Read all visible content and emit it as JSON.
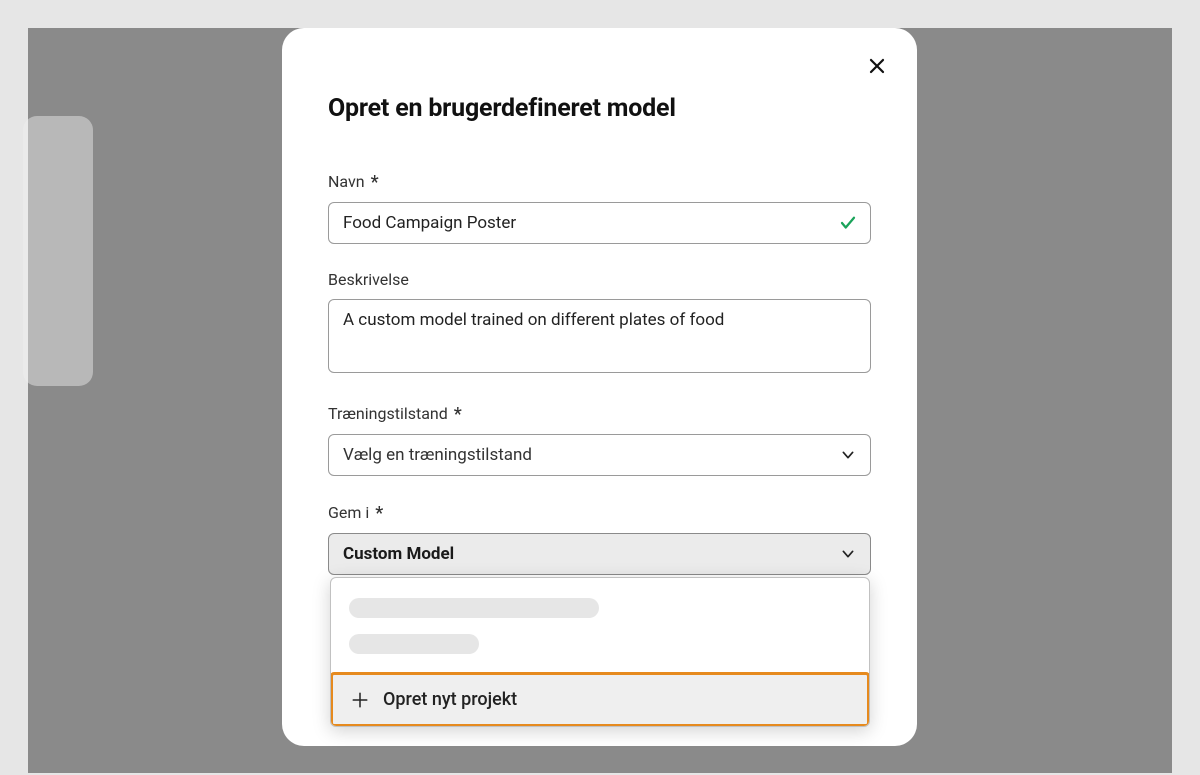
{
  "modal": {
    "title": "Opret en brugerdefineret model",
    "name": {
      "label": "Navn",
      "value": "Food Campaign Poster"
    },
    "description": {
      "label": "Beskrivelse",
      "value": "A custom model trained on different plates of food"
    },
    "training_mode": {
      "label": "Træningstilstand",
      "placeholder": "Vælg en træningstilstand"
    },
    "save_in": {
      "label": "Gem i",
      "selected": "Custom Model"
    },
    "required_marker": "*"
  },
  "dropdown": {
    "create_project_label": "Opret nyt projekt"
  }
}
